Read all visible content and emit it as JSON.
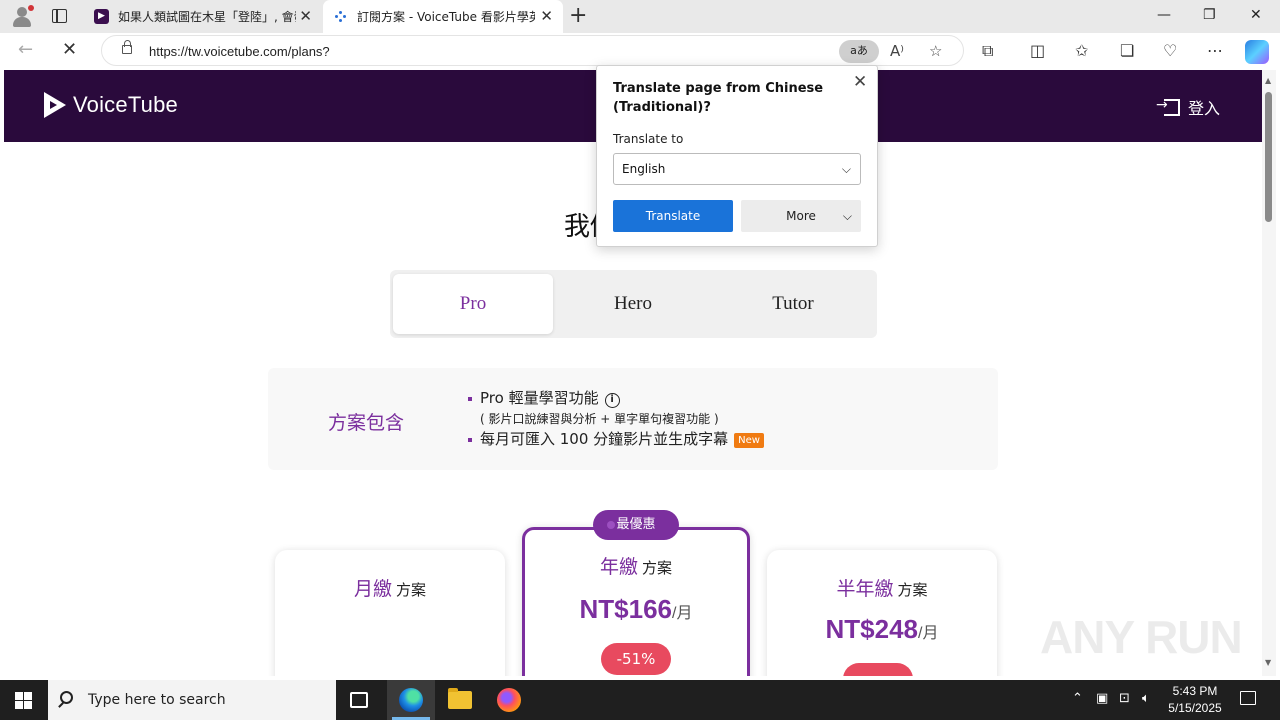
{
  "browser": {
    "tabs": [
      {
        "title": "如果人類試圖在木星「登陸」, 會發"
      },
      {
        "title": "訂閱方案 - VoiceTube 看影片學英"
      }
    ],
    "url": "https://tw.voicetube.com/plans?",
    "translate_chip": "aあ",
    "window_controls": {
      "minimize": "—",
      "restore": "❐",
      "close": "✕"
    }
  },
  "translate_popup": {
    "title": "Translate page from Chinese (Traditional)?",
    "label": "Translate to",
    "language": "English",
    "translate_button": "Translate",
    "more_button": "More"
  },
  "site": {
    "logo": "VoiceTube",
    "login": "登入",
    "headline": "我們",
    "plan_tabs": [
      "Pro",
      "Hero",
      "Tutor"
    ],
    "includes": {
      "label": "方案包含",
      "item1": "Pro 輕量學習功能",
      "item1_sub": "( 影片口說練習與分析 + 單字單句複習功能 )",
      "item2": "每月可匯入 100 分鐘影片並生成字幕",
      "new_badge": "New"
    },
    "best_badge": "最優惠",
    "cards": [
      {
        "name": "月繳",
        "suffix": "方案",
        "price": "",
        "unit": "",
        "discount": ""
      },
      {
        "name": "年繳",
        "suffix": "方案",
        "price": "NT$166",
        "unit": "/月",
        "discount": "-51%"
      },
      {
        "name": "半年繳",
        "suffix": "方案",
        "price": "NT$248",
        "unit": "/月",
        "discount": ""
      }
    ],
    "watermark": "ANY RUN"
  },
  "taskbar": {
    "search_placeholder": "Type here to search",
    "time": "5:43 PM",
    "date": "5/15/2025"
  }
}
